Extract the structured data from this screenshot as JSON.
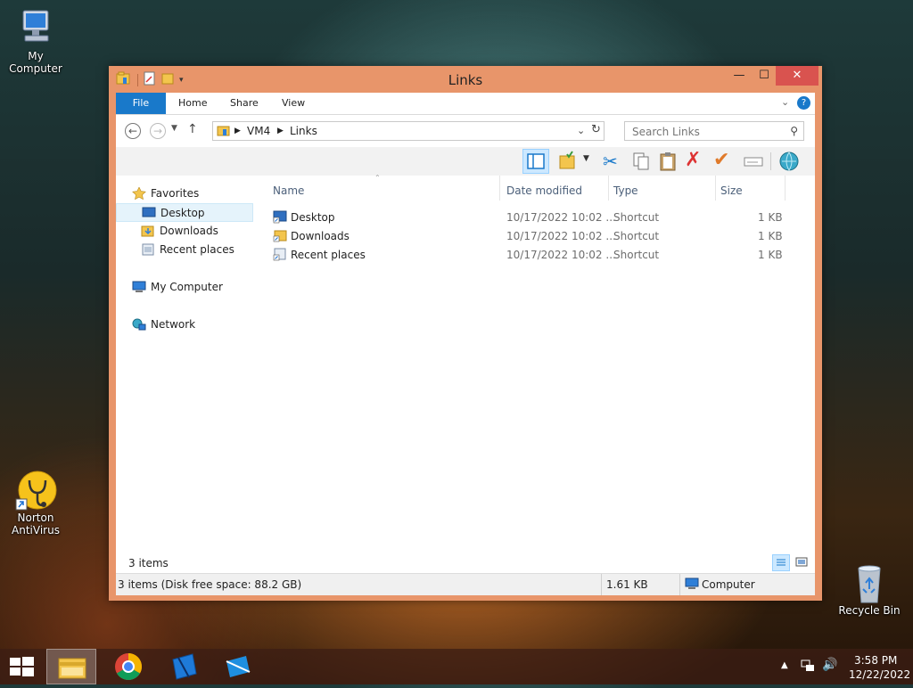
{
  "desktop": {
    "icons": [
      {
        "label": "My Computer"
      },
      {
        "label": "Norton AntiVirus"
      },
      {
        "label": "Recycle Bin"
      }
    ]
  },
  "window": {
    "title": "Links",
    "ribbon_tabs": [
      "File",
      "Home",
      "Share",
      "View"
    ],
    "breadcrumb": [
      "VM4",
      "Links"
    ],
    "search_placeholder": "Search Links",
    "nav": {
      "favorites": "Favorites",
      "desktop": "Desktop",
      "downloads": "Downloads",
      "recent": "Recent places",
      "computer": "My Computer",
      "network": "Network"
    },
    "columns": {
      "name": "Name",
      "date": "Date modified",
      "type": "Type",
      "size": "Size"
    },
    "files": [
      {
        "name": "Desktop",
        "date": "10/17/2022 10:02 ...",
        "type": "Shortcut",
        "size": "1 KB"
      },
      {
        "name": "Downloads",
        "date": "10/17/2022 10:02 ...",
        "type": "Shortcut",
        "size": "1 KB"
      },
      {
        "name": "Recent places",
        "date": "10/17/2022 10:02 ...",
        "type": "Shortcut",
        "size": "1 KB"
      }
    ],
    "item_count": "3 items",
    "status": {
      "left": "3 items (Disk free space: 88.2 GB)",
      "size": "1.61 KB",
      "location": "Computer"
    }
  },
  "taskbar": {
    "time": "3:58 PM",
    "date": "12/22/2022"
  },
  "colors": {
    "accent": "#1979ca",
    "window_frame": "#e8956a",
    "close": "#d9534f"
  }
}
